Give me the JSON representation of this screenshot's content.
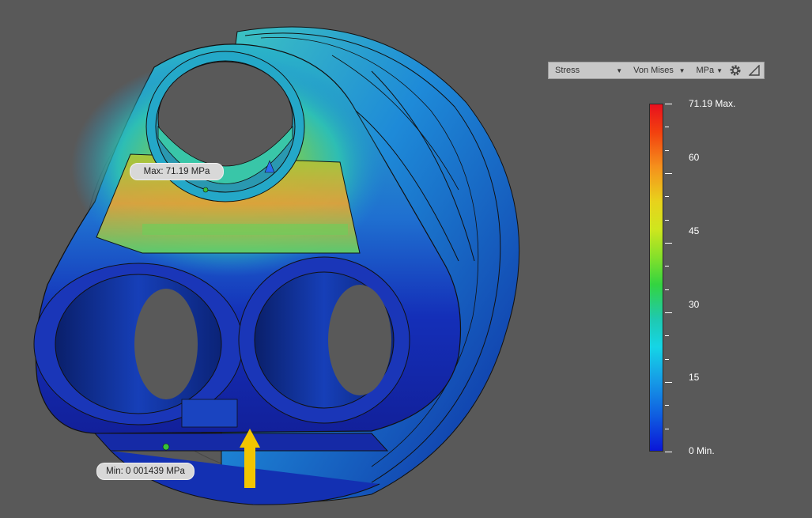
{
  "toolbar": {
    "result_type": "Stress",
    "criteria": "Von Mises",
    "units": "MPa",
    "settings_icon": "gear-icon",
    "probe_icon": "triangle-ruler-icon"
  },
  "legend": {
    "labels": [
      "71.19 Max.",
      "60",
      "45",
      "30",
      "15",
      "0 Min."
    ],
    "max_value": 71.19,
    "min_value": 0,
    "colors": [
      "#e8101e",
      "#f5901c",
      "#e8d21c",
      "#33d440",
      "#15d5e6",
      "#0a16d8"
    ]
  },
  "callouts": {
    "max": "Max: 71.19 MPa",
    "min": "Min: 0 001439 MPa"
  },
  "load_arrow_color": "#f2c500"
}
